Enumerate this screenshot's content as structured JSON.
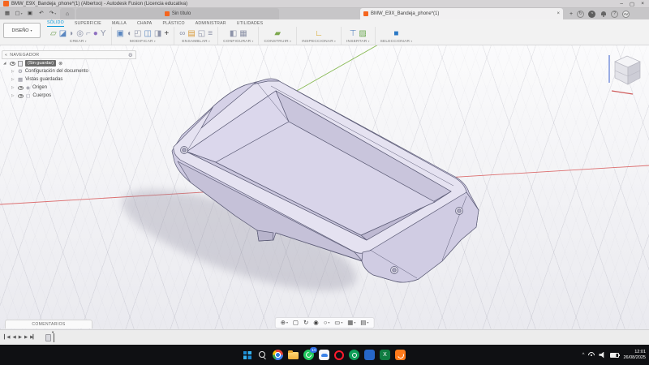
{
  "title_bar": {
    "title": "BMW_E9X_Bandeja_phone*(1) (Albertoo) - Autodesk Fusion (Licencia educativa)",
    "window_controls": [
      {
        "name": "minimize-button",
        "glyph": "–"
      },
      {
        "name": "maximize-button",
        "glyph": "▢"
      },
      {
        "name": "close-button",
        "glyph": "×"
      }
    ]
  },
  "tab_strip": {
    "quick_access": [
      {
        "name": "app-grid-icon",
        "glyph": "▦"
      },
      {
        "name": "file-menu-icon",
        "glyph": "▢",
        "caret": true
      },
      {
        "name": "save-icon",
        "glyph": "▣"
      },
      {
        "name": "undo-icon",
        "glyph": "↶"
      },
      {
        "name": "redo-icon",
        "glyph": "↷",
        "caret": true
      }
    ],
    "home_glyph": "⌂",
    "tabs": [
      {
        "label": "Sin título",
        "active": false
      },
      {
        "label": "BMW_E9X_Bandeja_phone*(1)",
        "active": true
      }
    ],
    "close_tab_glyph": "×",
    "utilities": [
      {
        "name": "new-tab-button",
        "glyph": "+"
      },
      {
        "name": "job-status-icon",
        "glyph": "↻",
        "style": "circle"
      },
      {
        "name": "notifications-icon",
        "glyph": "◔",
        "style": "circle-dark"
      },
      {
        "name": "bell-icon",
        "style": "bell"
      },
      {
        "name": "help-icon",
        "glyph": "?",
        "style": "circle"
      },
      {
        "name": "avatar",
        "glyph": "AV",
        "style": "avatar"
      }
    ]
  },
  "ribbon": {
    "design_menu": "DISEÑO",
    "tabs": [
      {
        "label": "SÓLIDO",
        "active": true
      },
      {
        "label": "SUPERFICIE",
        "active": false
      },
      {
        "label": "MALLA",
        "active": false
      },
      {
        "label": "CHAPA",
        "active": false
      },
      {
        "label": "PLÁSTICO",
        "active": false
      },
      {
        "label": "ADMINISTRAR",
        "active": false
      },
      {
        "label": "UTILIDADES",
        "active": false
      }
    ],
    "accent_color": "#0696d7",
    "groups": [
      {
        "label": "CREAR",
        "icons": [
          {
            "name": "create-sketch-icon",
            "glyph": "▱",
            "color": "#6f9f54"
          },
          {
            "name": "extrude-icon",
            "glyph": "◪",
            "color": "#5b87c0"
          },
          {
            "name": "revolve-icon",
            "glyph": "◗",
            "color": "#8d93a8"
          },
          {
            "name": "hole-icon",
            "glyph": "◎",
            "color": "#8d93a8"
          },
          {
            "name": "derive-icon",
            "glyph": "⌐",
            "color": "#9aa0b2"
          },
          {
            "name": "form-icon",
            "glyph": "●",
            "color": "#8e6fc0"
          },
          {
            "name": "pipe-icon",
            "glyph": "Y",
            "color": "#8d93a8"
          }
        ]
      },
      {
        "label": "MODIFICAR",
        "icons": [
          {
            "name": "press-pull-icon",
            "glyph": "▣",
            "color": "#5b87c0"
          },
          {
            "name": "fillet-icon",
            "glyph": "◖",
            "color": "#8d93a8"
          },
          {
            "name": "shell-icon",
            "glyph": "◰",
            "color": "#8d93a8"
          },
          {
            "name": "combine-icon",
            "glyph": "◫",
            "color": "#5b87c0"
          },
          {
            "name": "split-body-icon",
            "glyph": "◨",
            "color": "#8d93a8"
          },
          {
            "name": "move-copy-icon",
            "glyph": "+",
            "color": "#3a3a3a"
          }
        ]
      },
      {
        "label": "ENSAMBLAR",
        "icons": [
          {
            "name": "link-icon",
            "glyph": "∞",
            "color": "#8d93a8"
          },
          {
            "name": "new-component-icon",
            "glyph": "▤",
            "color": "#d99a3a"
          },
          {
            "name": "joint-icon",
            "glyph": "◱",
            "color": "#8d93a8"
          },
          {
            "name": "bom-icon",
            "glyph": "≡",
            "color": "#8d93a8"
          }
        ]
      },
      {
        "label": "CONFIGURAR",
        "icons": [
          {
            "name": "configure-icon",
            "glyph": "◧",
            "color": "#8d93a8"
          },
          {
            "name": "configuration-table-icon",
            "glyph": "▦",
            "color": "#8d93a8"
          }
        ]
      },
      {
        "label": "CONSTRUIR",
        "icons": [
          {
            "name": "construction-plane-icon",
            "glyph": "▰",
            "color": "#7da84e"
          }
        ]
      },
      {
        "label": "INSPECCIONAR",
        "icons": [
          {
            "name": "measure-icon",
            "glyph": "∟",
            "color": "#d4a017"
          }
        ]
      },
      {
        "label": "INSERTAR",
        "icons": [
          {
            "name": "insert-derive-icon",
            "glyph": "⊤",
            "color": "#5b87c0"
          },
          {
            "name": "canvas-icon",
            "glyph": "▨",
            "color": "#6aa84f"
          }
        ]
      },
      {
        "label": "SELECCIONAR",
        "icons": [
          {
            "name": "select-icon",
            "glyph": "■",
            "color": "#2a78c5"
          }
        ]
      }
    ]
  },
  "navigator": {
    "collapse_glyph": "«",
    "header": "NAVEGADOR",
    "root": {
      "label": "(Sin guardar)",
      "close_glyph": "⊗"
    },
    "items": [
      "Configuración del documento",
      "Vistas guardadas",
      "Origen",
      "Cuerpos"
    ]
  },
  "viewport": {
    "colors": {
      "model_body": "#d6d2e8",
      "x_axis": "#d95757",
      "y_axis": "#7cb342"
    }
  },
  "comments": {
    "label": "COMENTARIOS"
  },
  "view_nav_toolbar": {
    "items": [
      {
        "name": "pan-icon",
        "glyph": "⊕",
        "caret": true
      },
      {
        "name": "fit-icon",
        "glyph": "▢"
      },
      {
        "name": "orbit-icon",
        "glyph": "↻"
      },
      {
        "name": "look-at-icon",
        "glyph": "◉"
      },
      {
        "name": "zoom-icon",
        "glyph": "○",
        "caret": true
      },
      {
        "name": "display-settings-icon",
        "glyph": "▭",
        "caret": true
      },
      {
        "name": "grid-snaps-icon",
        "glyph": "▦",
        "caret": true
      },
      {
        "name": "viewports-icon",
        "glyph": "▤",
        "caret": true
      }
    ]
  },
  "timeline": {
    "controls": [
      {
        "name": "go-to-start-icon",
        "glyph": "▎◀"
      },
      {
        "name": "step-back-icon",
        "glyph": "◀"
      },
      {
        "name": "play-icon",
        "glyph": "▶"
      },
      {
        "name": "step-forward-icon",
        "glyph": "▶"
      },
      {
        "name": "go-to-end-icon",
        "glyph": "▶▎"
      }
    ]
  },
  "taskbar": {
    "icons": [
      {
        "name": "start-button",
        "style": "start"
      },
      {
        "name": "search-button",
        "style": "search"
      },
      {
        "name": "chrome-icon",
        "style": "chrome"
      },
      {
        "name": "file-explorer-icon",
        "style": "folder"
      },
      {
        "name": "whatsapp-icon",
        "style": "whatsapp",
        "bg": "#23c960",
        "badge": "14"
      },
      {
        "name": "photos-app-icon",
        "style": "cloud",
        "bg": "#f4f6fb"
      },
      {
        "name": "opera-icon",
        "style": "opera"
      },
      {
        "name": "green-app-icon",
        "style": "circle",
        "bg": "#0e9d58"
      },
      {
        "name": "office-app-icon",
        "style": "square",
        "bg": "#2667c9"
      },
      {
        "name": "excel-icon",
        "style": "excel",
        "glyph": "X",
        "bg": "#107c41"
      },
      {
        "name": "fusion-icon",
        "style": "fusion",
        "bg": "#ff7a1a",
        "active": true
      }
    ],
    "tray": {
      "time": "12:01",
      "date": "26/08/2025"
    }
  }
}
